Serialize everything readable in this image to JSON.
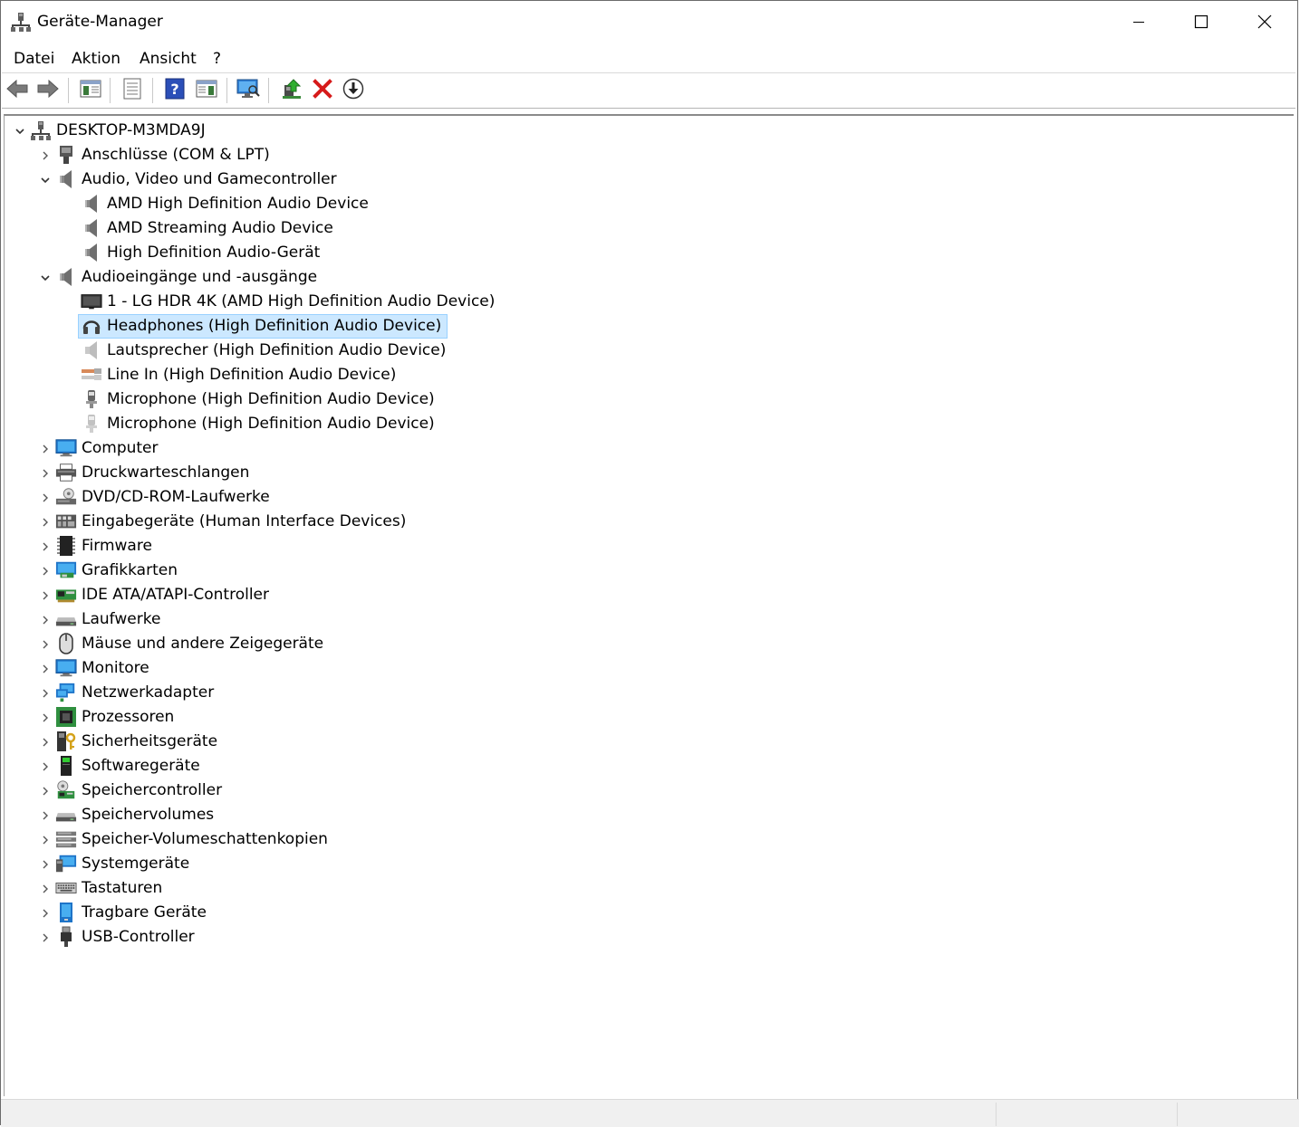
{
  "window": {
    "title": "Geräte-Manager",
    "controls": {
      "minimize": "minimize-icon",
      "maximize": "maximize-icon",
      "close": "close-icon"
    }
  },
  "menu": {
    "items": [
      {
        "label": "Datei"
      },
      {
        "label": "Aktion"
      },
      {
        "label": "Ansicht"
      },
      {
        "label": "?"
      }
    ]
  },
  "toolbar": {
    "buttons": [
      {
        "name": "back",
        "icon": "arrow-left-icon"
      },
      {
        "name": "forward",
        "icon": "arrow-right-icon"
      },
      {
        "name": "show-hide-console-tree",
        "icon": "console-tree-icon"
      },
      {
        "name": "properties",
        "icon": "properties-icon"
      },
      {
        "name": "help",
        "icon": "help-icon"
      },
      {
        "name": "show-hide-action-pane",
        "icon": "action-pane-icon"
      },
      {
        "name": "scan-hardware",
        "icon": "scan-monitor-icon"
      },
      {
        "name": "update-driver",
        "icon": "update-driver-icon"
      },
      {
        "name": "uninstall-device",
        "icon": "uninstall-x-icon"
      },
      {
        "name": "disable-device",
        "icon": "disable-arrow-down-icon"
      }
    ]
  },
  "tree": {
    "root": {
      "label": "DESKTOP-M3MDA9J",
      "icon": "computer-root-icon",
      "expanded": true
    },
    "items": [
      {
        "label": "Anschlüsse (COM & LPT)",
        "icon": "port-icon",
        "level": 1,
        "expanded": false
      },
      {
        "label": "Audio, Video und Gamecontroller",
        "icon": "speaker-icon",
        "level": 1,
        "expanded": true
      },
      {
        "label": "AMD High Definition Audio Device",
        "icon": "speaker-icon",
        "level": 2
      },
      {
        "label": "AMD Streaming Audio Device",
        "icon": "speaker-icon",
        "level": 2
      },
      {
        "label": "High Definition Audio-Gerät",
        "icon": "speaker-icon",
        "level": 2
      },
      {
        "label": "Audioeingänge und -ausgänge",
        "icon": "speaker-icon",
        "level": 1,
        "expanded": true
      },
      {
        "label": "1 - LG HDR 4K (AMD High Definition Audio Device)",
        "icon": "display-icon",
        "level": 2
      },
      {
        "label": "Headphones (High Definition Audio Device)",
        "icon": "headphones-icon",
        "level": 2,
        "selected": true
      },
      {
        "label": "Lautsprecher (High Definition Audio Device)",
        "icon": "speaker-light-icon",
        "level": 2
      },
      {
        "label": "Line In (High Definition Audio Device)",
        "icon": "line-in-icon",
        "level": 2
      },
      {
        "label": "Microphone (High Definition Audio Device)",
        "icon": "microphone-icon",
        "level": 2
      },
      {
        "label": "Microphone (High Definition Audio Device)",
        "icon": "microphone-light-icon",
        "level": 2
      },
      {
        "label": "Computer",
        "icon": "monitor-icon",
        "level": 1,
        "expanded": false
      },
      {
        "label": "Druckwarteschlangen",
        "icon": "printer-icon",
        "level": 1,
        "expanded": false
      },
      {
        "label": "DVD/CD-ROM-Laufwerke",
        "icon": "disc-drive-icon",
        "level": 1,
        "expanded": false
      },
      {
        "label": "Eingabegeräte (Human Interface Devices)",
        "icon": "hid-icon",
        "level": 1,
        "expanded": false
      },
      {
        "label": "Firmware",
        "icon": "chip-icon",
        "level": 1,
        "expanded": false
      },
      {
        "label": "Grafikkarten",
        "icon": "graphics-card-icon",
        "level": 1,
        "expanded": false
      },
      {
        "label": "IDE ATA/ATAPI-Controller",
        "icon": "ide-controller-icon",
        "level": 1,
        "expanded": false
      },
      {
        "label": "Laufwerke",
        "icon": "drive-icon",
        "level": 1,
        "expanded": false
      },
      {
        "label": "Mäuse und andere Zeigegeräte",
        "icon": "mouse-icon",
        "level": 1,
        "expanded": false
      },
      {
        "label": "Monitore",
        "icon": "monitor-icon",
        "level": 1,
        "expanded": false
      },
      {
        "label": "Netzwerkadapter",
        "icon": "network-icon",
        "level": 1,
        "expanded": false
      },
      {
        "label": "Prozessoren",
        "icon": "processor-icon",
        "level": 1,
        "expanded": false
      },
      {
        "label": "Sicherheitsgeräte",
        "icon": "security-key-icon",
        "level": 1,
        "expanded": false
      },
      {
        "label": "Softwaregeräte",
        "icon": "software-device-icon",
        "level": 1,
        "expanded": false
      },
      {
        "label": "Speichercontroller",
        "icon": "storage-controller-icon",
        "level": 1,
        "expanded": false
      },
      {
        "label": "Speichervolumes",
        "icon": "drive-icon",
        "level": 1,
        "expanded": false
      },
      {
        "label": "Speicher-Volumeschattenkopien",
        "icon": "drive-stack-icon",
        "level": 1,
        "expanded": false
      },
      {
        "label": "Systemgeräte",
        "icon": "system-device-icon",
        "level": 1,
        "expanded": false
      },
      {
        "label": "Tastaturen",
        "icon": "keyboard-icon",
        "level": 1,
        "expanded": false
      },
      {
        "label": "Tragbare Geräte",
        "icon": "portable-device-icon",
        "level": 1,
        "expanded": false
      },
      {
        "label": "USB-Controller",
        "icon": "usb-icon",
        "level": 1,
        "expanded": false
      }
    ]
  },
  "colors": {
    "selection_bg": "#cce8ff",
    "selection_border": "#99d1ff",
    "statusbar_bg": "#f0f0f0"
  }
}
